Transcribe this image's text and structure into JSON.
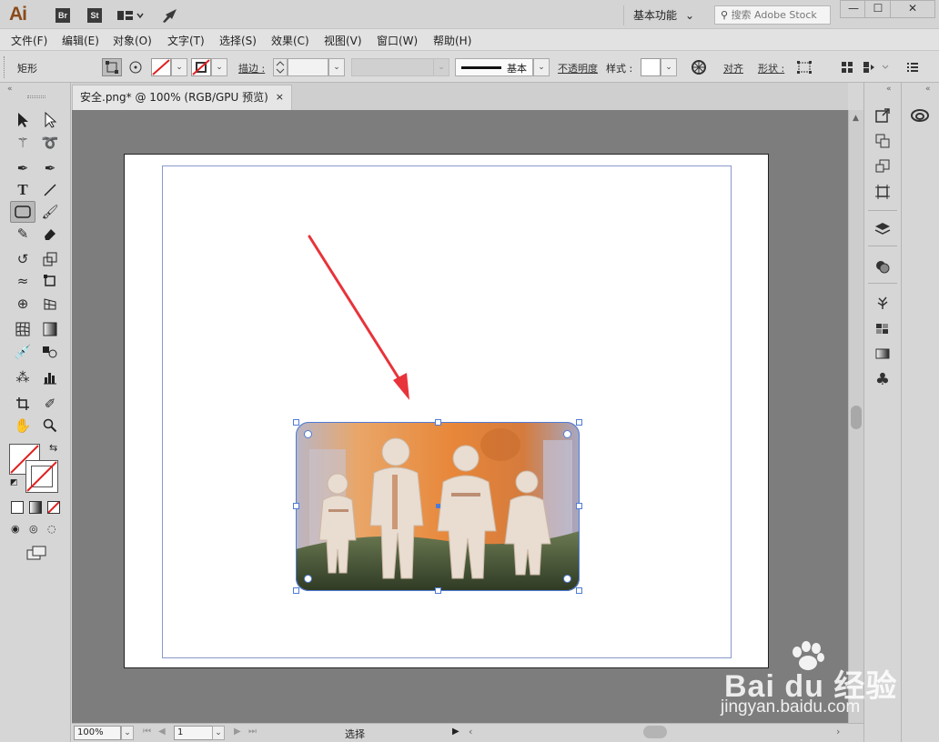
{
  "app": {
    "logo_text": "Ai",
    "bridge_label": "Br",
    "stock_label": "St"
  },
  "titlebar": {
    "workspace": "基本功能",
    "search_placeholder": "搜索 Adobe Stock"
  },
  "menu": {
    "items": [
      "文件(F)",
      "编辑(E)",
      "对象(O)",
      "文字(T)",
      "选择(S)",
      "效果(C)",
      "视图(V)",
      "窗口(W)",
      "帮助(H)"
    ]
  },
  "control": {
    "object_type": "矩形",
    "stroke_label": "描边 :",
    "stroke_profile": "基本",
    "opacity_label": "不透明度",
    "style_label": "样式 :",
    "align_label": "对齐",
    "shape_label": "形状 :"
  },
  "document": {
    "tab_title": "安全.png* @ 100% (RGB/GPU 预览)",
    "close_glyph": "×"
  },
  "status": {
    "zoom": "100%",
    "artboard_number": "1",
    "tool_name": "选择"
  },
  "watermark": {
    "brand": "Bai du 经验",
    "url": "jingyan.baidu.com"
  },
  "colors": {
    "arrow": "#e8333a",
    "selection": "#4f7bd6",
    "photo_orange": "#e8873a"
  }
}
